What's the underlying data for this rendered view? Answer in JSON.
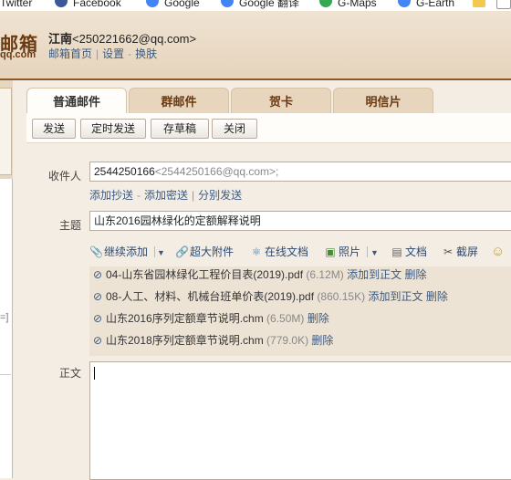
{
  "bookmarks": [
    "Twitter",
    "Facebook",
    "Google",
    "Google 翻译",
    "G-Maps",
    "G-Earth"
  ],
  "logo": {
    "big": "邮箱",
    "small": "qq.com"
  },
  "account": {
    "name": "江南",
    "email": "<250221662@qq.com>",
    "links": [
      "邮箱首页",
      "设置",
      "换肤"
    ]
  },
  "tabs": [
    "普通邮件",
    "群邮件",
    "贺卡",
    "明信片"
  ],
  "actions": [
    "发送",
    "定时发送",
    "存草稿",
    "关闭"
  ],
  "recipient": {
    "label": "收件人",
    "value": "2544250166",
    "value_hint": "<2544250166@qq.com>;",
    "links": [
      "添加抄送",
      "添加密送",
      "分别发送"
    ]
  },
  "subject": {
    "label": "主题",
    "value": "山东2016园林绿化的定额解释说明"
  },
  "attach_toolbar": [
    "继续添加",
    "超大附件",
    "在线文档",
    "照片",
    "文档",
    "截屏"
  ],
  "attachments": [
    {
      "name": "04-山东省园林绿化工程价目表(2019).pdf",
      "size": "(6.12M)",
      "actions": [
        "添加到正文",
        "删除"
      ]
    },
    {
      "name": "08-人工、材料、机械台班单价表(2019).pdf",
      "size": "(860.15K)",
      "actions": [
        "添加到正文",
        "删除"
      ]
    },
    {
      "name": "山东2016序列定额章节说明.chm",
      "size": "(6.50M)",
      "actions": [
        "删除"
      ]
    },
    {
      "name": "山东2018序列定额章节说明.chm",
      "size": "(779.0K)",
      "actions": [
        "删除"
      ]
    }
  ],
  "body": {
    "label": "正文",
    "value": ""
  },
  "side_glyph": "=]",
  "icons": {
    "clip": "paperclip-icon",
    "dropdown": "dropdown-arrow-icon",
    "big_attach": "big-attachment-icon",
    "online_doc": "online-doc-icon",
    "photo": "photo-icon",
    "doc": "document-icon",
    "screenshot": "scissors-icon",
    "emoji": "emoji-icon"
  },
  "colors": {
    "accent": "#8b5a2b",
    "link": "#3d5a80",
    "tab_bg": "#e7d5bd"
  }
}
